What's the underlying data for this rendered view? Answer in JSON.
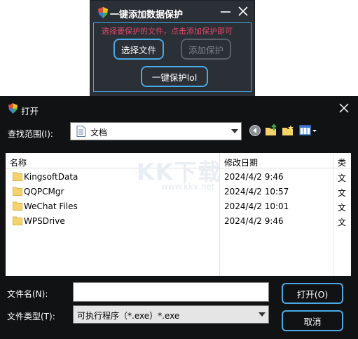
{
  "app": {
    "title": "一键添加数据保护",
    "hint": "选择要保护的文件，点击添加保护即可",
    "select_file_label": "选择文件",
    "add_protect_label": "添加保护",
    "oneclick_label": "一键保护lol"
  },
  "dialog": {
    "title": "打开",
    "lookin_label": "查找范围(I):",
    "lookin_value": "文档",
    "columns": {
      "name": "名称",
      "date": "修改日期",
      "type": "类"
    },
    "files": [
      {
        "name": "KingsoftData",
        "date": "2024/4/2 9:46",
        "type": "文"
      },
      {
        "name": "QQPCMgr",
        "date": "2024/4/2 10:57",
        "type": "文"
      },
      {
        "name": "WeChat Files",
        "date": "2024/4/2 10:01",
        "type": "文"
      },
      {
        "name": "WPSDrive",
        "date": "2024/4/2 9:46",
        "type": "文"
      }
    ],
    "filename_label": "文件名(N):",
    "filename_value": "",
    "filetype_label": "文件类型(T):",
    "filetype_value": "可执行程序（*.exe）*.exe",
    "open_label": "打开(O)",
    "cancel_label": "取消"
  },
  "watermark": {
    "logo": "KK下载",
    "url": "www.kkx.net"
  },
  "colors": {
    "accent": "#4aa9e6",
    "hint": "#e8456a",
    "app_bg": "#2b2f36",
    "dialog_bg": "#111214",
    "folder": "#f5d36c"
  },
  "icons": [
    "shield-icon",
    "minimize-icon",
    "close-icon",
    "document-icon",
    "back-icon",
    "up-folder-icon",
    "new-folder-icon",
    "view-menu-icon",
    "folder-icon",
    "dropdown-arrow-icon"
  ]
}
